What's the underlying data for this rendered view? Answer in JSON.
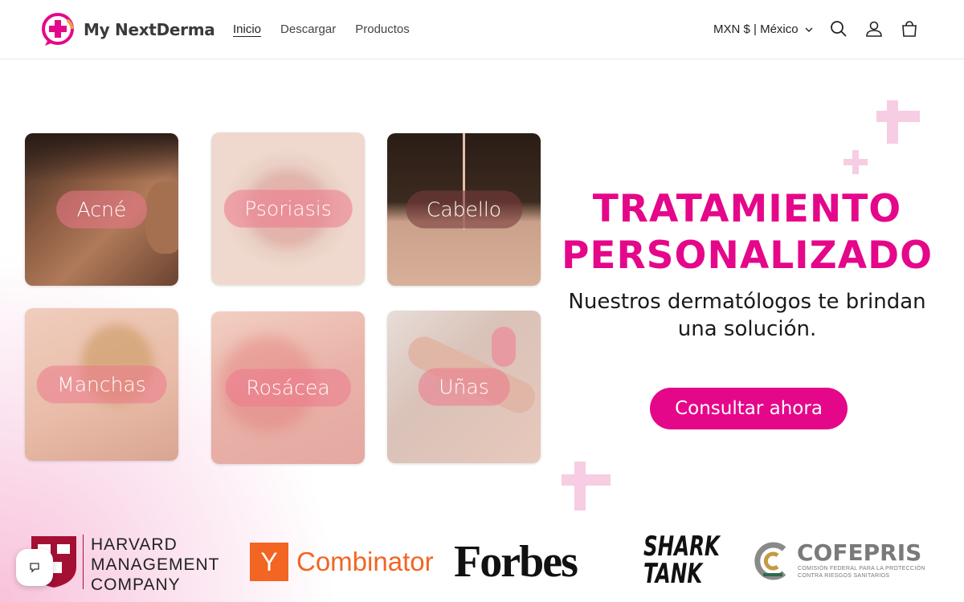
{
  "brand": {
    "name": "My NextDerma",
    "accent": "#e5078a"
  },
  "nav": {
    "items": [
      {
        "label": "Inicio",
        "active": true
      },
      {
        "label": "Descargar"
      },
      {
        "label": "Productos"
      }
    ]
  },
  "header": {
    "currency": "MXN $ | México",
    "icons": [
      "search-icon",
      "user-icon",
      "cart-icon"
    ]
  },
  "tiles": [
    {
      "label": "Acné"
    },
    {
      "label": "Psoriasis"
    },
    {
      "label": "Cabello"
    },
    {
      "label": "Manchas"
    },
    {
      "label": "Rosácea"
    },
    {
      "label": "Uñas"
    }
  ],
  "hero": {
    "title_line1": "TRATAMIENTO",
    "title_line2": "PERSONALIZADO",
    "subtitle_line1": "Nuestros dermatólogos te brindan",
    "subtitle_line2": "una solución.",
    "cta": "Consultar ahora"
  },
  "logos": {
    "harvard": [
      "HARVARD",
      "MANAGEMENT",
      "COMPANY"
    ],
    "yc_letter": "Y",
    "yc_name": "Combinator",
    "forbes": "Forbes",
    "shark": [
      "SHARK",
      "TANK"
    ],
    "cofepris": "COFEPRIS",
    "cofepris_sub1": "COMISIÓN FEDERAL PARA LA PROTECCIÓN",
    "cofepris_sub2": "CONTRA RIESGOS SANITARIOS"
  }
}
